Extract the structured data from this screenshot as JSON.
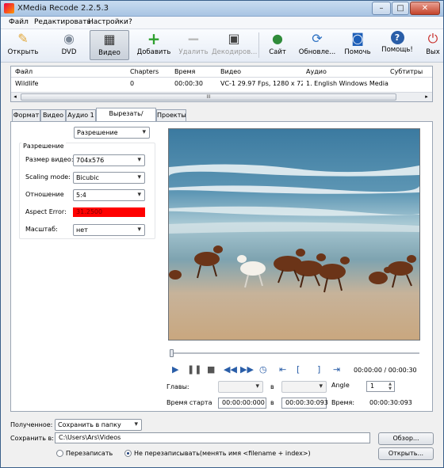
{
  "window": {
    "title": "XMedia Recode 2.2.5.3",
    "minimize": "–",
    "maximize": "□",
    "close": "✕"
  },
  "menu": [
    "Файл",
    "Редактировать",
    "Настройки",
    "?"
  ],
  "toolbar": {
    "open": "Открыть",
    "dvd": "DVD",
    "video": "Видео",
    "add": "Добавить",
    "delete": "Удалить",
    "decode": "Декодиров...",
    "site": "Сайт",
    "update": "Обновле...",
    "help": "Помочь",
    "help2": "Помощь!",
    "exit": "Вых"
  },
  "file_table": {
    "headers": [
      "Файл",
      "Chapters",
      "Время",
      "Видео",
      "Аудио",
      "Субтитры"
    ],
    "row": [
      "Wildlife",
      "0",
      "00:00:30",
      "VC-1 29.97 Fps, 1280 x 72...",
      "1. English Windows Media ...",
      ""
    ],
    "scroll_grip": "III"
  },
  "tabs": [
    "Формат",
    "Видео",
    "Аудио 1",
    "Вырезать/Превью",
    "Проекты"
  ],
  "left": {
    "mode_select": "Разрешение",
    "group_title": "Разрешение",
    "size_label": "Размер видео:",
    "size_value": "704x576",
    "scaling_label": "Scaling mode:",
    "scaling_value": "Bicubic",
    "ratio_label": "Отношение",
    "ratio_value": "5:4",
    "aspect_label": "Aspect Error:",
    "aspect_value": "31.2500",
    "scale_label": "Масштаб:",
    "scale_value": "нет"
  },
  "player": {
    "time": "00:00:00 / 00:00:30",
    "chapters_label": "Главы:",
    "in_label": "в",
    "in_label2": "в",
    "angle_label": "Angle",
    "angle_value": "1",
    "start_label": "Время старта",
    "start_value": "00:00:00:000",
    "end_value": "00:00:30:093",
    "duration_label": "Время:",
    "duration_value": "00:00:30:093"
  },
  "bottom": {
    "received_label": "Полученное:",
    "received_value": "Сохранить в папку",
    "save_label": "Сохранить в:",
    "save_path": "C:\\Users\\Ars\\Videos",
    "browse": "Обзор...",
    "overwrite": "Перезаписать",
    "no_overwrite": "Не перезаписывать(менять имя <filename + index>)",
    "open": "Открыть..."
  },
  "colors": {
    "accent": "#2a5ea8",
    "aspect_error_bg": "#ff0000"
  }
}
